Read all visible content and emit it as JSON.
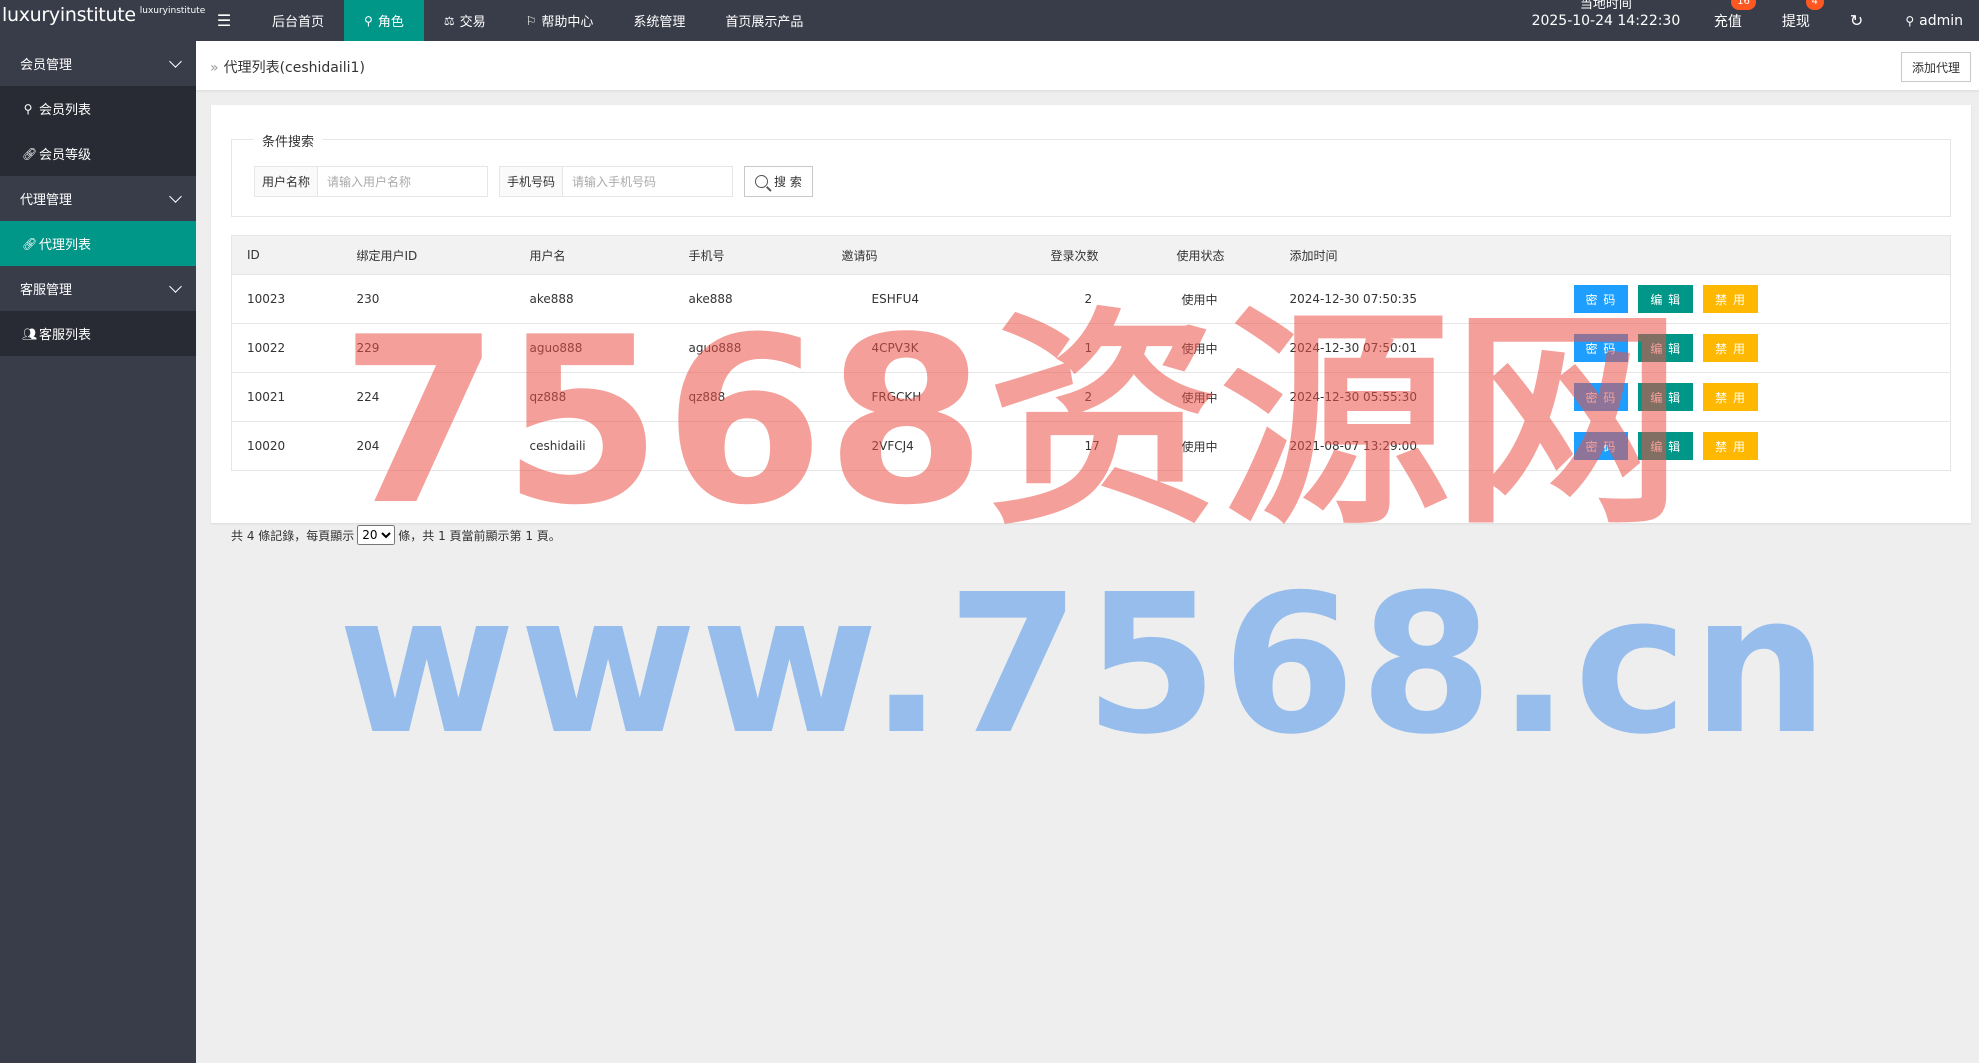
{
  "app": {
    "logo": "luxuryinstitute",
    "logo_sup": "luxuryinstitute"
  },
  "nav": [
    {
      "label": "后台首页",
      "icon": ""
    },
    {
      "label": "角色",
      "icon": "user-icon"
    },
    {
      "label": "交易",
      "icon": "scale-icon"
    },
    {
      "label": "帮助中心",
      "icon": "flag-icon"
    },
    {
      "label": "系统管理",
      "icon": ""
    },
    {
      "label": "首页展示产品",
      "icon": ""
    }
  ],
  "header": {
    "clock_label": "当地时间",
    "clock_time": "2025-10-24 14:22:30",
    "recharge_label": "充值",
    "recharge_badge": "16",
    "withdraw_label": "提现",
    "withdraw_badge": "4",
    "user": "admin"
  },
  "sidebar": {
    "groups": [
      {
        "label": "会员管理",
        "items": [
          {
            "label": "会员列表",
            "icon": "user-icon"
          },
          {
            "label": "会员等级",
            "icon": "link-icon"
          }
        ]
      },
      {
        "label": "代理管理",
        "items": [
          {
            "label": "代理列表",
            "icon": "link-icon"
          }
        ]
      },
      {
        "label": "客服管理",
        "items": [
          {
            "label": "客服列表",
            "icon": "users-icon"
          }
        ]
      }
    ]
  },
  "breadcrumb": {
    "title": "代理列表(ceshidaili1)"
  },
  "actions": {
    "add_agent": "添加代理"
  },
  "search": {
    "legend": "条件搜索",
    "username_label": "用户名称",
    "username_placeholder": "请输入用户名称",
    "phone_label": "手机号码",
    "phone_placeholder": "请输入手机号码",
    "button": "搜 索"
  },
  "table": {
    "headers": [
      "ID",
      "绑定用户ID",
      "用户名",
      "手机号",
      "邀请码",
      "登录次数",
      "使用状态",
      "添加时间",
      ""
    ],
    "rows": [
      {
        "id": "10023",
        "uid": "230",
        "username": "ake888",
        "phone": "ake888",
        "invite": "ESHFU4",
        "logins": "2",
        "status": "使用中",
        "time": "2024-12-30 07:50:35"
      },
      {
        "id": "10022",
        "uid": "229",
        "username": "aguo888",
        "phone": "aguo888",
        "invite": "4CPV3K",
        "logins": "1",
        "status": "使用中",
        "time": "2024-12-30 07:50:01"
      },
      {
        "id": "10021",
        "uid": "224",
        "username": "qz888",
        "phone": "qz888",
        "invite": "FRGCKH",
        "logins": "2",
        "status": "使用中",
        "time": "2024-12-30 05:55:30"
      },
      {
        "id": "10020",
        "uid": "204",
        "username": "ceshidaili",
        "phone": "",
        "invite": "2VFCJ4",
        "logins": "17",
        "status": "使用中",
        "time": "2021-08-07 13:29:00"
      }
    ],
    "ops": {
      "pwd": "密 码",
      "edit": "编 辑",
      "ban": "禁 用"
    }
  },
  "pager": {
    "prefix": "共 4 條記錄，每頁顯示",
    "per_page": "20",
    "suffix": "條，共 1 頁當前顯示第 1 頁。"
  },
  "watermark": {
    "line1": "7568资源网",
    "line2": "www.7568.cn"
  },
  "colors": {
    "topbar": "#393d49",
    "accent": "#009688",
    "blue": "#1e9fff",
    "orange": "#ffb800",
    "badge": "#ff5722"
  }
}
